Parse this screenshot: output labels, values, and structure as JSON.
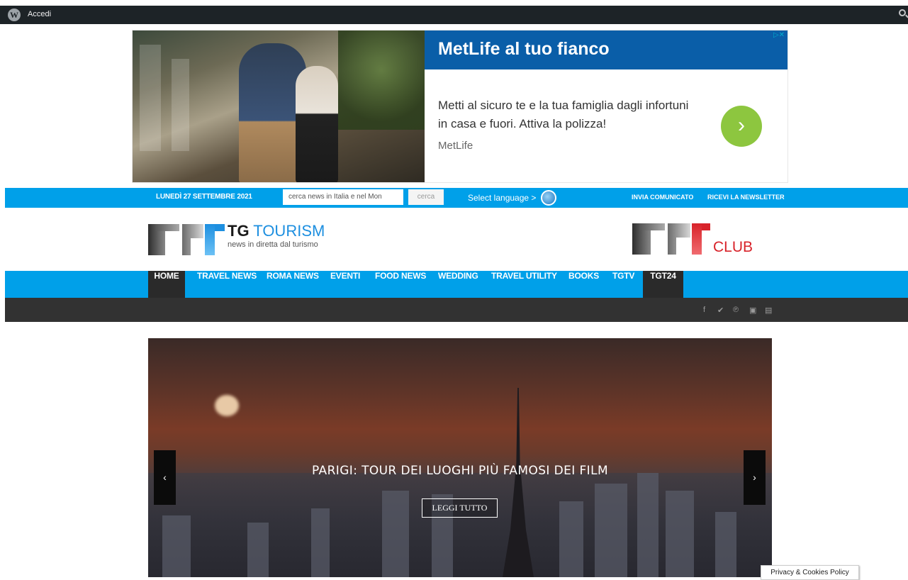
{
  "admin_bar": {
    "wp_logo_icon": "wordpress-icon",
    "login_label": "Accedi",
    "search_icon": "search-icon"
  },
  "ad": {
    "title": "MetLife al tuo fianco",
    "description": "Metti al sicuro te e la tua famiglia dagli infortuni in casa e fuori. Attiva la polizza!",
    "brand": "MetLife",
    "cta_icon": "chevron-right-icon",
    "adchoices_label": "▷✕",
    "colors": {
      "header": "#0a5ea8",
      "cta": "#8dc63f"
    }
  },
  "topbar": {
    "date": "LUNEDÌ 27 SETTEMBRE 2021",
    "search_placeholder": "cerca news in Italia e nel Mon",
    "search_button": "cerca",
    "language_label": "Select language >",
    "globe_icon": "globe-icon",
    "send_press_release": "INVIA COMUNICATO",
    "newsletter": "RICEVI LA NEWSLETTER",
    "color": "#00a0e9"
  },
  "header": {
    "logo_brand_bold": "TG",
    "logo_brand": " TOURISM",
    "logo_tagline": "news in diretta dal turismo",
    "club_label": "CLUB"
  },
  "nav": {
    "items": [
      {
        "label": "HOME"
      },
      {
        "label": "TRAVEL NEWS"
      },
      {
        "label": "ROMA NEWS"
      },
      {
        "label": "EVENTI"
      },
      {
        "label": "FOOD NEWS"
      },
      {
        "label": "WEDDING"
      },
      {
        "label": "TRAVEL UTILITY"
      },
      {
        "label": "BOOKS"
      },
      {
        "label": "TGTV"
      },
      {
        "label": "TGT24"
      }
    ],
    "social": [
      "facebook-icon",
      "twitter-icon",
      "pinterest-icon",
      "instagram-icon",
      "youtube-icon"
    ]
  },
  "slider": {
    "caption": "PARIGI: TOUR DEI LUOGHI PIÙ FAMOSI DEI FILM",
    "read_more": "LEGGI TUTTO",
    "prev_label": "‹",
    "next_label": "›"
  },
  "privacy": {
    "label": "Privacy & Cookies Policy"
  }
}
